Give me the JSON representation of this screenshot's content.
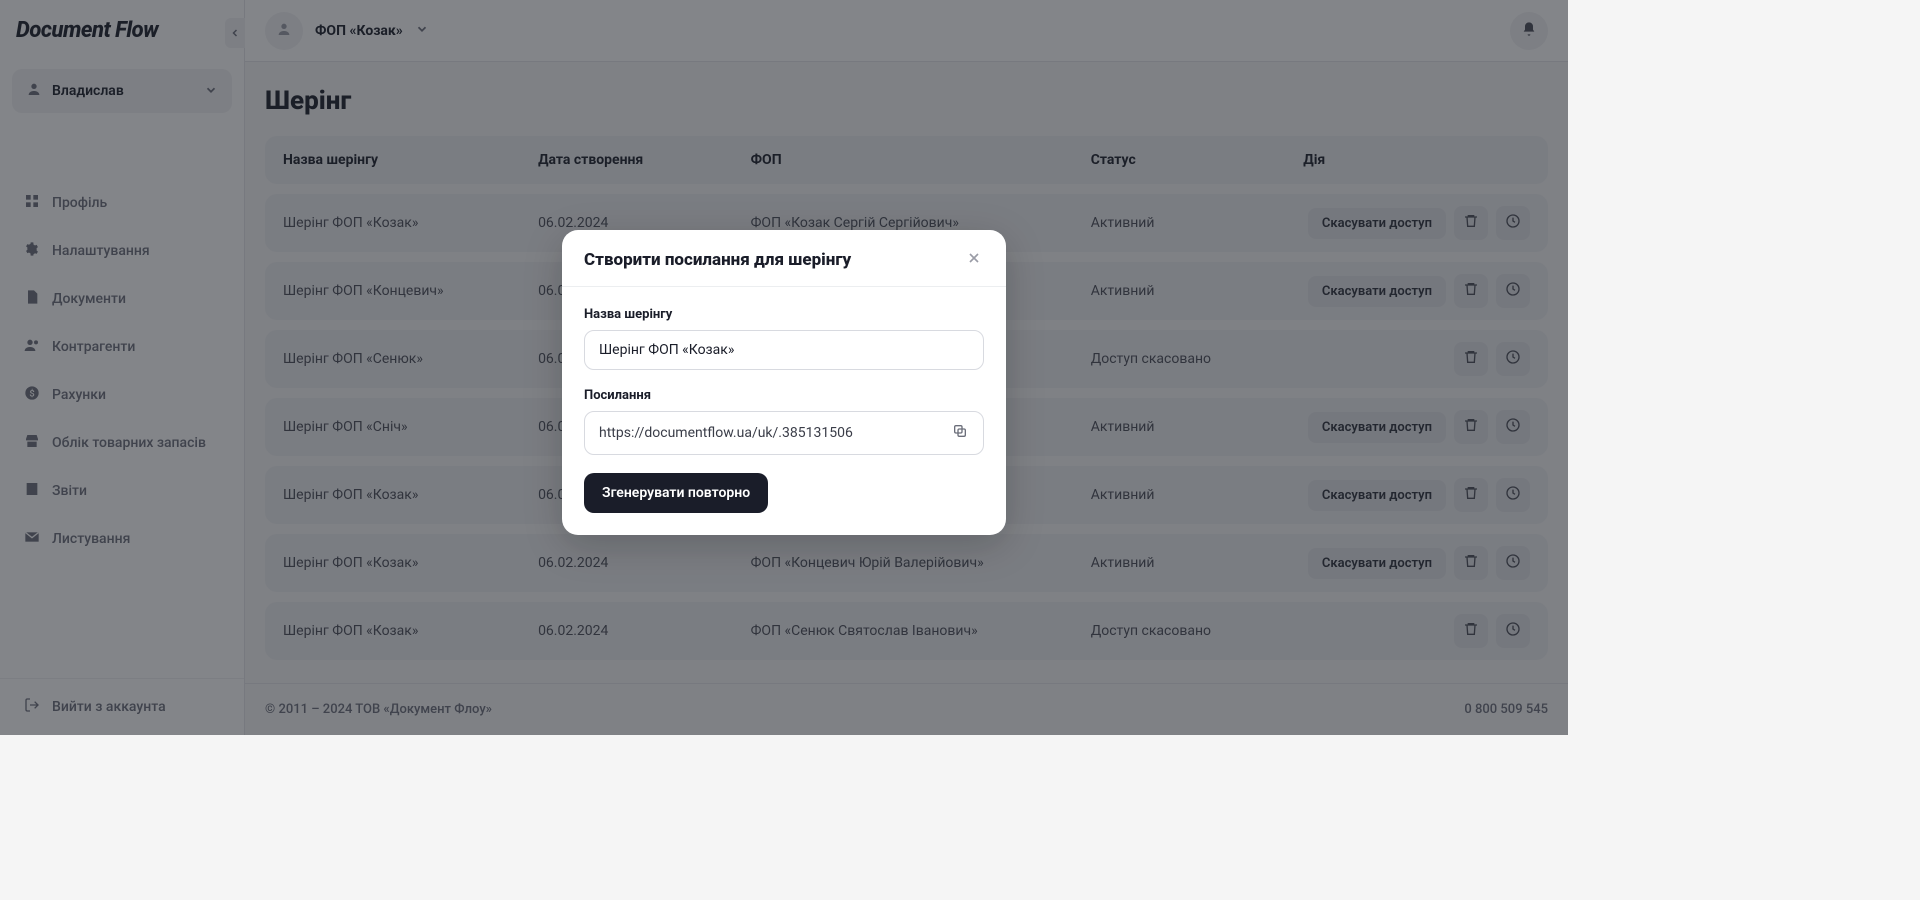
{
  "brand": "Document Flow",
  "user": {
    "name": "Владислав"
  },
  "org": {
    "name": "ФОП «Козак»"
  },
  "nav": {
    "items": [
      {
        "label": "Профіль"
      },
      {
        "label": "Налаштування"
      },
      {
        "label": "Документи"
      },
      {
        "label": "Контрагенти"
      },
      {
        "label": "Рахунки"
      },
      {
        "label": "Облік товарних запасів"
      },
      {
        "label": "Звіти"
      },
      {
        "label": "Листування"
      }
    ],
    "logout": "Вийти з аккаунта"
  },
  "page": {
    "title": "Шерінг"
  },
  "table": {
    "headers": {
      "name": "Назва шерінгу",
      "created": "Дата створення",
      "fop": "ФОП",
      "status": "Статус",
      "action": "Дія"
    },
    "cancel_label": "Скасувати доступ",
    "rows": [
      {
        "name": "Шерінг ФОП «Козак»",
        "created": "06.02.2024",
        "fop": "ФОП «Козак Сергій Сергійович»",
        "status": "Активний",
        "cancelable": true
      },
      {
        "name": "Шерінг ФОП «Концевич»",
        "created": "06.02.2024",
        "fop": "",
        "status": "Активний",
        "cancelable": true
      },
      {
        "name": "Шерінг ФОП «Сенюк»",
        "created": "06.02.2024",
        "fop": "",
        "status": "Доступ скасовано",
        "cancelable": false
      },
      {
        "name": "Шерінг ФОП «Сніч»",
        "created": "06.02.2024",
        "fop": "",
        "status": "Активний",
        "cancelable": true
      },
      {
        "name": "Шерінг ФОП «Козак»",
        "created": "06.02.2024",
        "fop": "",
        "status": "Активний",
        "cancelable": true
      },
      {
        "name": "Шерінг ФОП «Козак»",
        "created": "06.02.2024",
        "fop": "ФОП «Концевич Юрій Валерійович»",
        "status": "Активний",
        "cancelable": true
      },
      {
        "name": "Шерінг ФОП «Козак»",
        "created": "06.02.2024",
        "fop": "ФОП «Сенюк Святослав Іванович»",
        "status": "Доступ скасовано",
        "cancelable": false
      }
    ]
  },
  "footer": {
    "copyright": "© 2011 – 2024 ТОВ «Документ Флоу»",
    "phone": "0 800 509 545"
  },
  "modal": {
    "title": "Створити посилання для шерінгу",
    "name_label": "Назва шерінгу",
    "name_value": "Шерінг ФОП «Козак»",
    "link_label": "Посилання",
    "link_value": "https://documentflow.ua/uk/.385131506",
    "regenerate": "Згенерувати повторно"
  }
}
